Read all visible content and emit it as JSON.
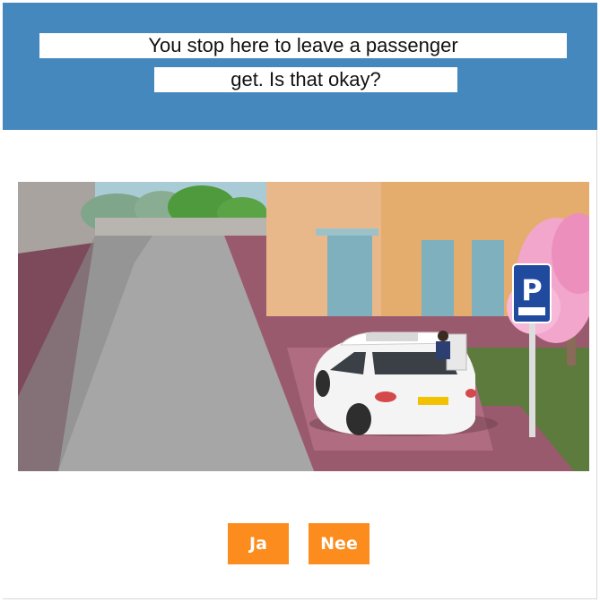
{
  "question": {
    "line1": "You stop here to leave a passenger",
    "line2": "get. Is that okay?"
  },
  "answers": {
    "yes_label": "Ja",
    "no_label": "Nee"
  },
  "colors": {
    "header": "#4588be",
    "button": "#fb8c1d"
  }
}
